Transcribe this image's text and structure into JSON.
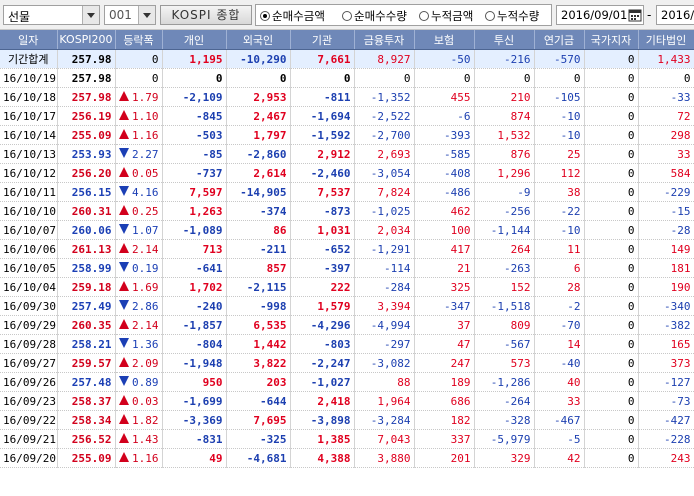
{
  "toolbar": {
    "market_select": "선물",
    "code_select": "001",
    "index_button": "KOSPI 종합",
    "radios": [
      {
        "label": "순매수금액",
        "checked": true
      },
      {
        "label": "순매수수량",
        "checked": false
      },
      {
        "label": "누적금액",
        "checked": false
      },
      {
        "label": "누적수량",
        "checked": false
      }
    ],
    "start_date": "2016/09/01",
    "separator": "-",
    "end_date": "2016/",
    "calendar_icon": "calendar-icon"
  },
  "colors": {
    "header_bg": "#6f88b8",
    "summary_bg": "#e4efff",
    "positive": "#e0001f",
    "negative": "#1c3fb0"
  },
  "columns": [
    "일자",
    "KOSPI200",
    "등락폭",
    "개인",
    "외국인",
    "기관",
    "금융투자",
    "보험",
    "투신",
    "연기금",
    "국가지자",
    "기타법인"
  ],
  "rows": [
    {
      "date": "기간합계",
      "kospi": "257.98",
      "dir": "",
      "chg": "0",
      "vals": [
        "1,195",
        "-10,290",
        "7,661",
        "8,927",
        "-50",
        "-216",
        "-570",
        "0",
        "1,433"
      ],
      "summary": true
    },
    {
      "date": "16/10/19",
      "kospi": "257.98",
      "dir": "",
      "chg": "0",
      "vals": [
        "0",
        "0",
        "0",
        "0",
        "0",
        "0",
        "0",
        "0",
        "0"
      ]
    },
    {
      "date": "16/10/18",
      "kospi": "257.98",
      "dir": "up",
      "chg": "1.79",
      "vals": [
        "-2,109",
        "2,953",
        "-811",
        "-1,352",
        "455",
        "210",
        "-105",
        "0",
        "-33"
      ]
    },
    {
      "date": "16/10/17",
      "kospi": "256.19",
      "dir": "up",
      "chg": "1.10",
      "vals": [
        "-845",
        "2,467",
        "-1,694",
        "-2,522",
        "-6",
        "874",
        "-10",
        "0",
        "72"
      ]
    },
    {
      "date": "16/10/14",
      "kospi": "255.09",
      "dir": "up",
      "chg": "1.16",
      "vals": [
        "-503",
        "1,797",
        "-1,592",
        "-2,700",
        "-393",
        "1,532",
        "-10",
        "0",
        "298"
      ]
    },
    {
      "date": "16/10/13",
      "kospi": "253.93",
      "dir": "down",
      "chg": "2.27",
      "vals": [
        "-85",
        "-2,860",
        "2,912",
        "2,693",
        "-585",
        "876",
        "25",
        "0",
        "33"
      ]
    },
    {
      "date": "16/10/12",
      "kospi": "256.20",
      "dir": "up",
      "chg": "0.05",
      "vals": [
        "-737",
        "2,614",
        "-2,460",
        "-3,054",
        "-408",
        "1,296",
        "112",
        "0",
        "584"
      ]
    },
    {
      "date": "16/10/11",
      "kospi": "256.15",
      "dir": "down",
      "chg": "4.16",
      "vals": [
        "7,597",
        "-14,905",
        "7,537",
        "7,824",
        "-486",
        "-9",
        "38",
        "0",
        "-229"
      ]
    },
    {
      "date": "16/10/10",
      "kospi": "260.31",
      "dir": "up",
      "chg": "0.25",
      "vals": [
        "1,263",
        "-374",
        "-873",
        "-1,025",
        "462",
        "-256",
        "-22",
        "0",
        "-15"
      ]
    },
    {
      "date": "16/10/07",
      "kospi": "260.06",
      "dir": "down",
      "chg": "1.07",
      "vals": [
        "-1,089",
        "86",
        "1,031",
        "2,034",
        "100",
        "-1,144",
        "-10",
        "0",
        "-28"
      ]
    },
    {
      "date": "16/10/06",
      "kospi": "261.13",
      "dir": "up",
      "chg": "2.14",
      "vals": [
        "713",
        "-211",
        "-652",
        "-1,291",
        "417",
        "264",
        "11",
        "0",
        "149"
      ]
    },
    {
      "date": "16/10/05",
      "kospi": "258.99",
      "dir": "down",
      "chg": "0.19",
      "vals": [
        "-641",
        "857",
        "-397",
        "-114",
        "21",
        "-263",
        "6",
        "0",
        "181"
      ]
    },
    {
      "date": "16/10/04",
      "kospi": "259.18",
      "dir": "up",
      "chg": "1.69",
      "vals": [
        "1,702",
        "-2,115",
        "222",
        "-284",
        "325",
        "152",
        "28",
        "0",
        "190"
      ]
    },
    {
      "date": "16/09/30",
      "kospi": "257.49",
      "dir": "down",
      "chg": "2.86",
      "vals": [
        "-240",
        "-998",
        "1,579",
        "3,394",
        "-347",
        "-1,518",
        "-2",
        "0",
        "-340"
      ]
    },
    {
      "date": "16/09/29",
      "kospi": "260.35",
      "dir": "up",
      "chg": "2.14",
      "vals": [
        "-1,857",
        "6,535",
        "-4,296",
        "-4,994",
        "37",
        "809",
        "-70",
        "0",
        "-382"
      ]
    },
    {
      "date": "16/09/28",
      "kospi": "258.21",
      "dir": "down",
      "chg": "1.36",
      "vals": [
        "-804",
        "1,442",
        "-803",
        "-297",
        "47",
        "-567",
        "14",
        "0",
        "165"
      ]
    },
    {
      "date": "16/09/27",
      "kospi": "259.57",
      "dir": "up",
      "chg": "2.09",
      "vals": [
        "-1,948",
        "3,822",
        "-2,247",
        "-3,082",
        "247",
        "573",
        "-40",
        "0",
        "373"
      ]
    },
    {
      "date": "16/09/26",
      "kospi": "257.48",
      "dir": "down",
      "chg": "0.89",
      "vals": [
        "950",
        "203",
        "-1,027",
        "88",
        "189",
        "-1,286",
        "40",
        "0",
        "-127"
      ]
    },
    {
      "date": "16/09/23",
      "kospi": "258.37",
      "dir": "up",
      "chg": "0.03",
      "vals": [
        "-1,699",
        "-644",
        "2,418",
        "1,964",
        "686",
        "-264",
        "33",
        "0",
        "-73"
      ]
    },
    {
      "date": "16/09/22",
      "kospi": "258.34",
      "dir": "up",
      "chg": "1.82",
      "vals": [
        "-3,369",
        "7,695",
        "-3,898",
        "-3,284",
        "182",
        "-328",
        "-467",
        "0",
        "-427"
      ]
    },
    {
      "date": "16/09/21",
      "kospi": "256.52",
      "dir": "up",
      "chg": "1.43",
      "vals": [
        "-831",
        "-325",
        "1,385",
        "7,043",
        "337",
        "-5,979",
        "-5",
        "0",
        "-228"
      ]
    },
    {
      "date": "16/09/20",
      "kospi": "255.09",
      "dir": "up",
      "chg": "1.16",
      "vals": [
        "49",
        "-4,681",
        "4,388",
        "3,880",
        "201",
        "329",
        "42",
        "0",
        "243"
      ]
    }
  ]
}
